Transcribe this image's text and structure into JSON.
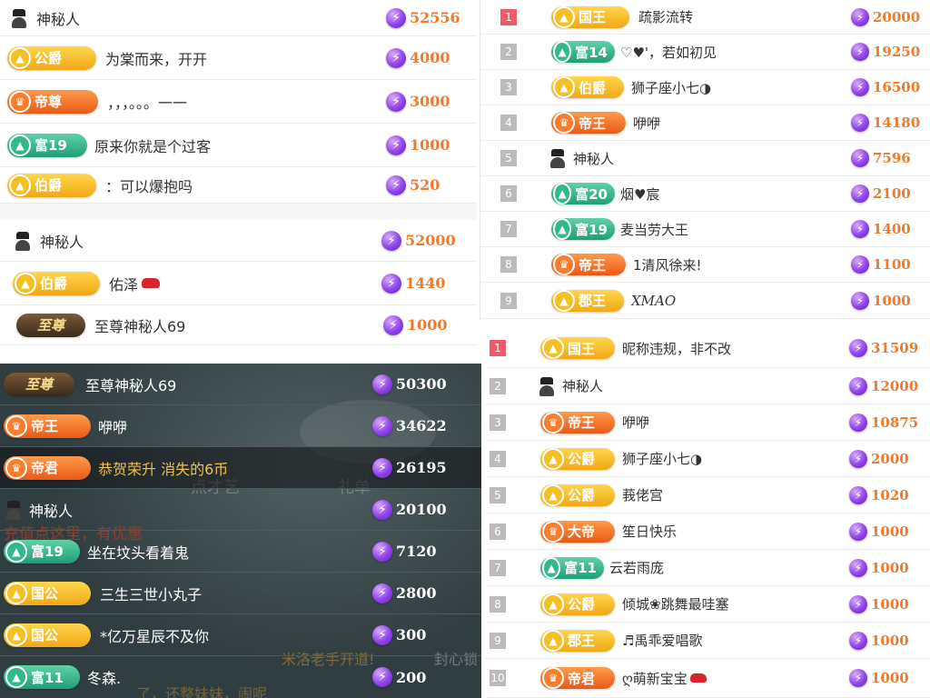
{
  "panelA": {
    "rows": [
      {
        "badge": "",
        "name": "神秘人",
        "amount": "52556"
      },
      {
        "badge": "公爵",
        "name": "为棠而来，开开",
        "amount": "4000"
      },
      {
        "badge": "帝尊",
        "name": "，，，。。。一一",
        "amount": "3000"
      },
      {
        "badge": "富19",
        "name": "原来你就是个过客",
        "amount": "1000"
      },
      {
        "badge": "伯爵",
        "name": "：可以爆抱吗",
        "amount": "520"
      },
      {
        "badge": "",
        "name": "神秘人",
        "amount": "52000"
      },
      {
        "badge": "伯爵",
        "name": "佑泽",
        "amount": "1440"
      },
      {
        "badge": "至尊",
        "name": "至尊神秘人69",
        "amount": "1000"
      }
    ]
  },
  "panelB": {
    "rows": [
      {
        "rank": "1",
        "badge": "国王",
        "name": "疏影流转",
        "amount": "20000"
      },
      {
        "rank": "2",
        "badge": "富14",
        "name": "♡♥'，若如初见",
        "amount": "19250"
      },
      {
        "rank": "3",
        "badge": "伯爵",
        "name": "狮子座小七◑",
        "amount": "16500"
      },
      {
        "rank": "4",
        "badge": "帝王",
        "name": "咿咿",
        "amount": "14180"
      },
      {
        "rank": "5",
        "badge": "",
        "name": "神秘人",
        "amount": "7596"
      },
      {
        "rank": "6",
        "badge": "富20",
        "name": "烟♥宸",
        "amount": "2100"
      },
      {
        "rank": "7",
        "badge": "富19",
        "name": "麦当劳大王",
        "amount": "1400"
      },
      {
        "rank": "8",
        "badge": "帝王",
        "name": "1清风徐来!",
        "amount": "1100"
      },
      {
        "rank": "9",
        "badge": "郡王",
        "name": "XMAO",
        "amount": "1000"
      }
    ]
  },
  "panelC": {
    "rows": [
      {
        "badge": "至尊",
        "name": "至尊神秘人69",
        "amount": "50300"
      },
      {
        "badge": "帝王",
        "name": "咿咿",
        "amount": "34622"
      },
      {
        "badge": "帝君",
        "name": "恭贺荣升 消失的6币",
        "amount": "26195"
      },
      {
        "badge": "",
        "name": "神秘人",
        "amount": "20100"
      },
      {
        "badge": "富19",
        "name": "坐在坟头看着鬼",
        "amount": "7120"
      },
      {
        "badge": "国公",
        "name": "三生三世小丸子",
        "amount": "2800"
      },
      {
        "badge": "国公",
        "name": "*亿万星辰不及你",
        "amount": "300"
      },
      {
        "badge": "富11",
        "name": "冬森.",
        "amount": "200"
      }
    ],
    "bg_text": {
      "tab1": "点才艺",
      "tab2": "礼单",
      "promo": "充值点这里，有优惠",
      "chat1": "米洛老手开道!",
      "chat2": "封心锁",
      "chat3": "了，还整妹妹，闹呢"
    }
  },
  "panelD": {
    "rows": [
      {
        "rank": "1",
        "badge": "国王",
        "name": "昵称违规，非不改",
        "amount": "31509"
      },
      {
        "rank": "2",
        "badge": "",
        "name": "神秘人",
        "amount": "12000"
      },
      {
        "rank": "3",
        "badge": "帝王",
        "name": "咿咿",
        "amount": "10875"
      },
      {
        "rank": "4",
        "badge": "公爵",
        "name": "狮子座小七◑",
        "amount": "2000"
      },
      {
        "rank": "5",
        "badge": "公爵",
        "name": "莪佬宫",
        "amount": "1020"
      },
      {
        "rank": "6",
        "badge": "大帝",
        "name": "笙日快乐",
        "amount": "1000"
      },
      {
        "rank": "7",
        "badge": "富11",
        "name": "云若雨庞",
        "amount": "1000"
      },
      {
        "rank": "8",
        "badge": "公爵",
        "name": "倾城❀跳舞最哇塞",
        "amount": "1000"
      },
      {
        "rank": "9",
        "badge": "郡王",
        "name": "♬禹乖爱唱歌",
        "amount": "1000"
      },
      {
        "rank": "10",
        "badge": "帝君",
        "name": "ღ萌新宝宝",
        "amount": "1000"
      }
    ]
  },
  "colors": {
    "gold": "#f0a818",
    "orange": "#e85a18",
    "teal": "#1f9e79",
    "amount": "#f07a2a",
    "gem": "#8e44e8",
    "rank1": "#f25a6a"
  }
}
